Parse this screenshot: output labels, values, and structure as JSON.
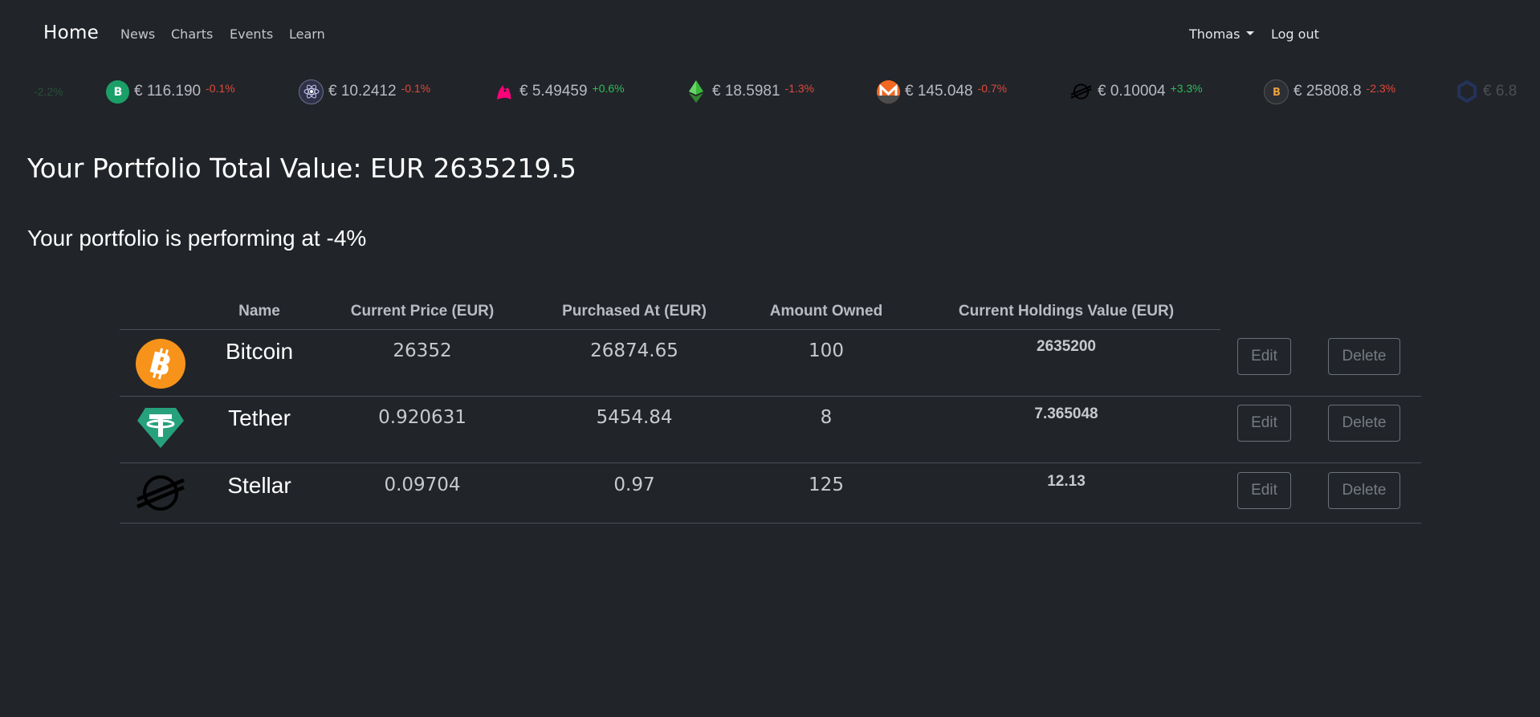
{
  "navbar": {
    "brand": "Home",
    "links": [
      "News",
      "Charts",
      "Events",
      "Learn"
    ],
    "user_menu": "Thomas",
    "logout": "Log out"
  },
  "ticker": [
    {
      "icon": "partial-icon",
      "price": "",
      "change": "-2.2%",
      "direction": "down",
      "faded": true
    },
    {
      "icon": "bitcoin-cash-icon",
      "price": "€ 116.190",
      "change": "-0.1%",
      "direction": "down"
    },
    {
      "icon": "cosmos-icon",
      "price": "€ 10.2412",
      "change": "-0.1%",
      "direction": "down"
    },
    {
      "icon": "uniswap-icon",
      "price": "€ 5.49459",
      "change": "+0.6%",
      "direction": "up"
    },
    {
      "icon": "ethereum-classic-icon",
      "price": "€ 18.5981",
      "change": "-1.3%",
      "direction": "down"
    },
    {
      "icon": "monero-icon",
      "price": "€ 145.048",
      "change": "-0.7%",
      "direction": "down"
    },
    {
      "icon": "stellar-icon",
      "price": "€ 0.10004",
      "change": "+3.3%",
      "direction": "up"
    },
    {
      "icon": "bitcoin-sv-icon",
      "price": "€ 25808.8",
      "change": "-2.3%",
      "direction": "down"
    },
    {
      "icon": "chainlink-icon",
      "price": "€ 6.8",
      "change": "",
      "direction": "down",
      "faded": true
    }
  ],
  "portfolio": {
    "total_label": "Your Portfolio Total Value: EUR 2635219.5",
    "performance_label": "Your portfolio is performing at -4%"
  },
  "table": {
    "headers": [
      "Name",
      "Current Price (EUR)",
      "Purchased At (EUR)",
      "Amount Owned",
      "Current Holdings Value (EUR)"
    ],
    "rows": [
      {
        "icon": "bitcoin-icon",
        "name": "Bitcoin",
        "current_price": "26352",
        "purchased_at": "26874.65",
        "amount": "100",
        "holdings": "2635200",
        "edit": "Edit",
        "delete": "Delete"
      },
      {
        "icon": "tether-icon",
        "name": "Tether",
        "current_price": "0.920631",
        "purchased_at": "5454.84",
        "amount": "8",
        "holdings": "7.365048",
        "edit": "Edit",
        "delete": "Delete"
      },
      {
        "icon": "stellar-icon",
        "name": "Stellar",
        "current_price": "0.09704",
        "purchased_at": "0.97",
        "amount": "125",
        "holdings": "12.13",
        "edit": "Edit",
        "delete": "Delete"
      }
    ]
  },
  "colors": {
    "background": "#212429",
    "negative": "#e04a3b",
    "positive": "#2ebd5a",
    "bitcoin": "#f7931a",
    "tether": "#26a17b"
  }
}
